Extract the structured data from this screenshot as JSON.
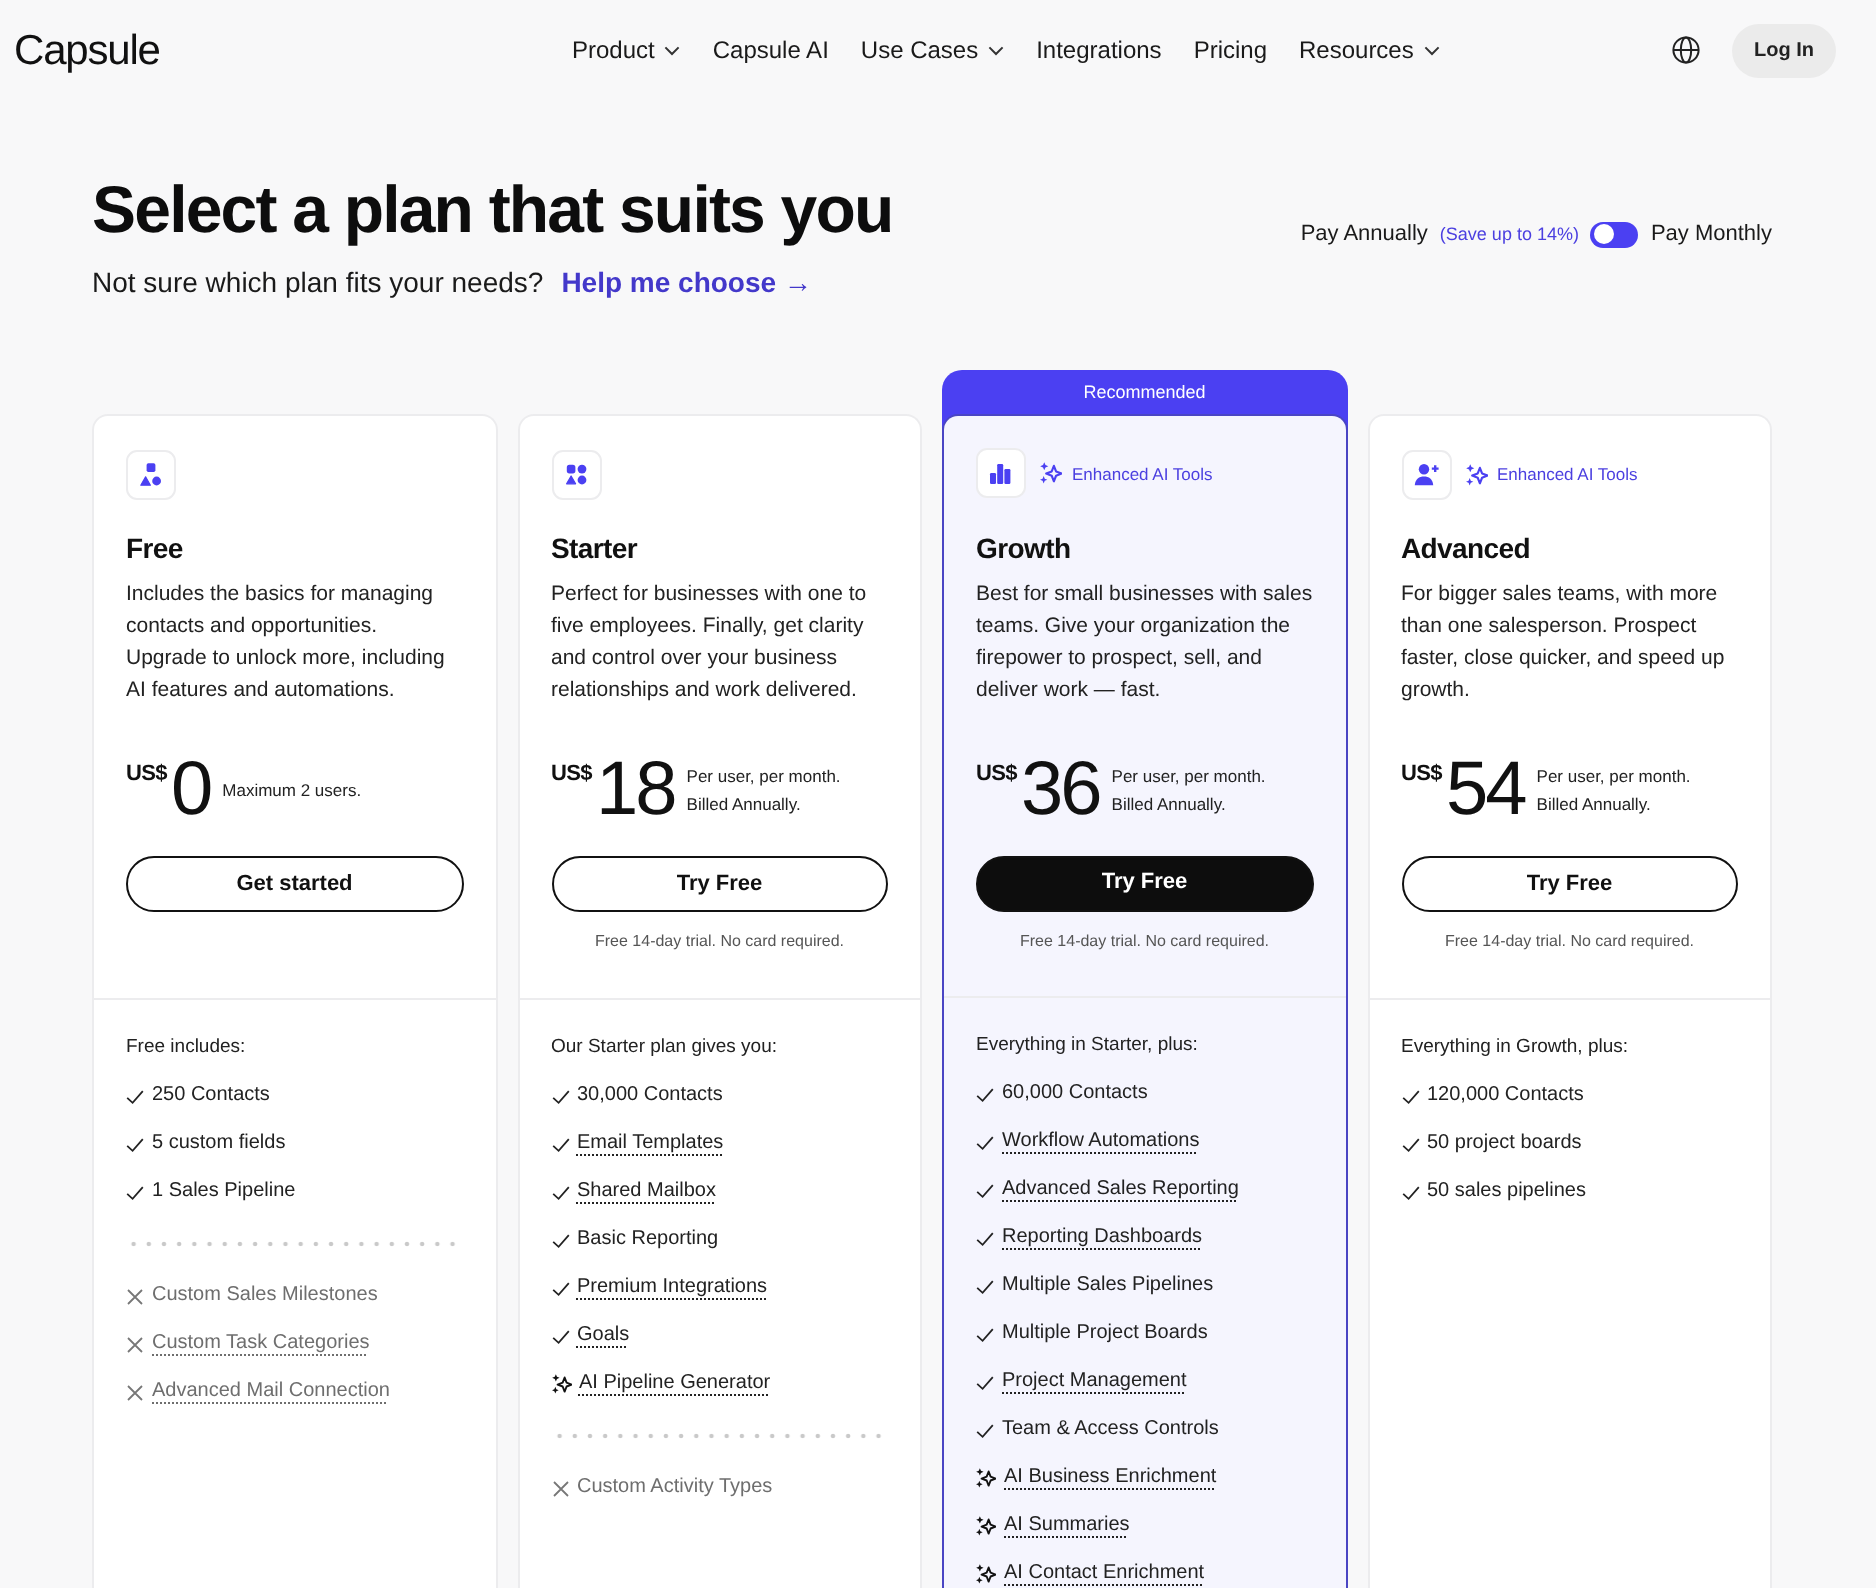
{
  "header": {
    "logo": "Capsule",
    "nav": [
      {
        "label": "Product",
        "dropdown": true
      },
      {
        "label": "Capsule AI",
        "dropdown": false
      },
      {
        "label": "Use Cases",
        "dropdown": true
      },
      {
        "label": "Integrations",
        "dropdown": false
      },
      {
        "label": "Pricing",
        "dropdown": false
      },
      {
        "label": "Resources",
        "dropdown": true
      }
    ],
    "login": "Log In"
  },
  "hero": {
    "title": "Select a plan that suits you",
    "subtitle": "Not sure which plan fits your needs?",
    "help_link": "Help me choose →"
  },
  "billing": {
    "annual_label": "Pay Annually",
    "save_note": "(Save up to 14%)",
    "monthly_label": "Pay Monthly",
    "monthly": false
  },
  "plans": [
    {
      "kind": "shapes",
      "name": "Free",
      "recommended": false,
      "description": "Includes the basics for managing contacts and opportunities. Upgrade to unlock more, including AI features and automations.",
      "currency": "US$",
      "price": "0",
      "price_notes": [
        "Maximum 2 users."
      ],
      "button": {
        "label": "Get started",
        "primary": false
      },
      "features_heading": "Free includes:",
      "features": [
        {
          "kind": "check",
          "text": "250 Contacts",
          "underlined": false
        },
        {
          "kind": "check",
          "text": "5 custom fields",
          "underlined": false
        },
        {
          "kind": "check",
          "text": "1 Sales Pipeline",
          "underlined": false
        }
      ],
      "excluded": [
        {
          "text": "Custom Sales Milestones",
          "underlined": false
        },
        {
          "text": "Custom Task Categories",
          "underlined": true
        },
        {
          "text": "Advanced Mail Connection",
          "underlined": true
        }
      ]
    },
    {
      "kind": "blocks",
      "name": "Starter",
      "recommended": false,
      "description": "Perfect for businesses with one to five employees. Finally, get clarity and control over your business relationships and work delivered.",
      "currency": "US$",
      "price": "18",
      "price_notes": [
        "Per user, per month.",
        "Billed Annually."
      ],
      "button": {
        "label": "Try Free",
        "primary": false
      },
      "trial_note": "Free 14-day trial. No card required.",
      "features_heading": "Our Starter plan gives you:",
      "features": [
        {
          "kind": "check",
          "text": "30,000 Contacts",
          "underlined": false
        },
        {
          "kind": "check",
          "text": "Email Templates",
          "underlined": true
        },
        {
          "kind": "check",
          "text": "Shared Mailbox",
          "underlined": true
        },
        {
          "kind": "check",
          "text": "Basic Reporting",
          "underlined": false
        },
        {
          "kind": "check",
          "text": "Premium Integrations",
          "underlined": true
        },
        {
          "kind": "check",
          "text": "Goals",
          "underlined": true
        },
        {
          "kind": "ai",
          "text": "AI Pipeline Generator",
          "underlined": true
        }
      ],
      "excluded": [
        {
          "text": "Custom Activity Types",
          "underlined": false
        }
      ]
    },
    {
      "kind": "chart",
      "name": "Growth",
      "recommended": true,
      "ribbon": "Recommended",
      "ai_badge": "Enhanced AI Tools",
      "description": "Best for small businesses with sales teams. Give your organization the firepower to prospect, sell, and deliver work — fast.",
      "currency": "US$",
      "price": "36",
      "price_notes": [
        "Per user, per month.",
        "Billed Annually."
      ],
      "button": {
        "label": "Try Free",
        "primary": true
      },
      "trial_note": "Free 14-day trial. No card required.",
      "features_heading": "Everything in Starter, plus:",
      "features": [
        {
          "kind": "check",
          "text": "60,000 Contacts",
          "underlined": false
        },
        {
          "kind": "check",
          "text": "Workflow Automations",
          "underlined": true
        },
        {
          "kind": "check",
          "text": "Advanced Sales Reporting",
          "underlined": true
        },
        {
          "kind": "check",
          "text": "Reporting Dashboards",
          "underlined": true
        },
        {
          "kind": "check",
          "text": "Multiple Sales Pipelines",
          "underlined": false
        },
        {
          "kind": "check",
          "text": "Multiple Project Boards",
          "underlined": false
        },
        {
          "kind": "check",
          "text": "Project Management",
          "underlined": true
        },
        {
          "kind": "check",
          "text": "Team & Access Controls",
          "underlined": false
        },
        {
          "kind": "ai",
          "text": "AI Business Enrichment",
          "underlined": true
        },
        {
          "kind": "ai",
          "text": "AI Summaries",
          "underlined": true
        },
        {
          "kind": "ai",
          "text": "AI Contact Enrichment",
          "underlined": true
        }
      ]
    },
    {
      "kind": "person",
      "name": "Advanced",
      "recommended": false,
      "ai_badge": "Enhanced AI Tools",
      "description": "For bigger sales teams, with more than one salesperson. Prospect faster, close quicker, and speed up growth.",
      "currency": "US$",
      "price": "54",
      "price_notes": [
        "Per user, per month.",
        "Billed Annually."
      ],
      "button": {
        "label": "Try Free",
        "primary": false
      },
      "trial_note": "Free 14-day trial. No card required.",
      "features_heading": "Everything in Growth, plus:",
      "features": [
        {
          "kind": "check",
          "text": "120,000 Contacts",
          "underlined": false
        },
        {
          "kind": "check",
          "text": "50 project boards",
          "underlined": false
        },
        {
          "kind": "check",
          "text": "50 sales pipelines",
          "underlined": false
        }
      ]
    }
  ]
}
